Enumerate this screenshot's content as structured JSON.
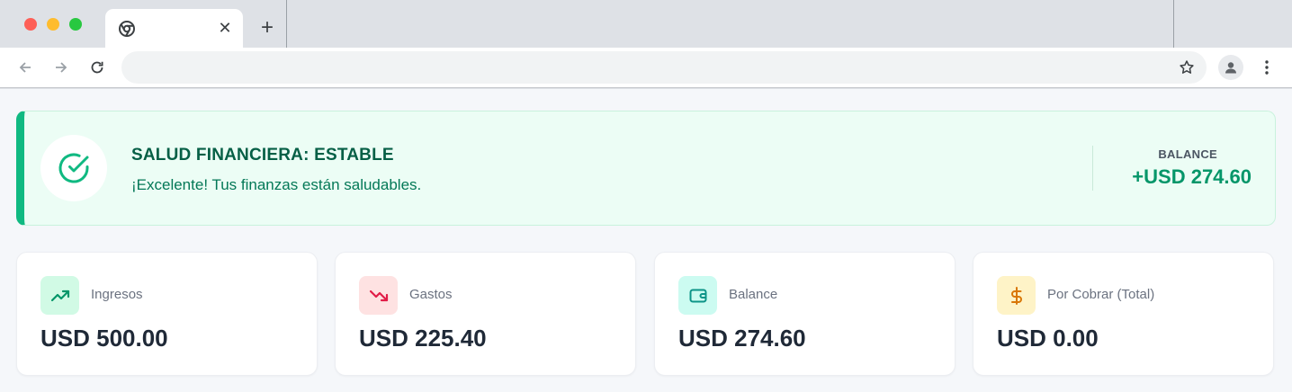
{
  "browser": {
    "tab_close_glyph": "✕",
    "new_tab_glyph": "+",
    "omnibox_value": "",
    "icons": [
      "chrome-favicon-icon",
      "back-arrow-icon",
      "forward-arrow-icon",
      "reload-icon",
      "star-icon",
      "profile-icon",
      "kebab-menu-icon"
    ]
  },
  "health": {
    "title": "SALUD FINANCIERA: ESTABLE",
    "message": "¡Excelente! Tus finanzas están saludables.",
    "balance_label": "BALANCE",
    "balance_value": "+USD 274.60",
    "icon": "check-circle-icon",
    "accent_color": "#10b981"
  },
  "stats": [
    {
      "label": "Ingresos",
      "value": "USD 500.00",
      "icon": "trending-up-icon",
      "icon_bg": "#d1fae5",
      "icon_color": "#059669"
    },
    {
      "label": "Gastos",
      "value": "USD 225.40",
      "icon": "trending-down-icon",
      "icon_bg": "#fee2e2",
      "icon_color": "#e11d48"
    },
    {
      "label": "Balance",
      "value": "USD 274.60",
      "icon": "wallet-icon",
      "icon_bg": "#ccfbf1",
      "icon_color": "#0d9488"
    },
    {
      "label": "Por Cobrar (Total)",
      "value": "USD 0.00",
      "icon": "dollar-icon",
      "icon_bg": "#fef3c7",
      "icon_color": "#d97706"
    }
  ]
}
